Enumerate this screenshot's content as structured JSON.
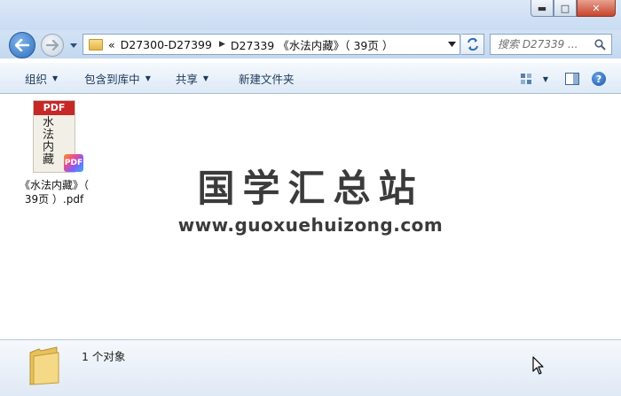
{
  "window": {
    "controls": {
      "minimize": "▬",
      "maximize": "□",
      "close": "✕"
    }
  },
  "address": {
    "overflow": "«",
    "segments": [
      "D27300-D27399",
      "D27339 《水法内藏》（ 39页 ）"
    ],
    "separator": "▶"
  },
  "search": {
    "placeholder": "搜索 D27339 ..."
  },
  "toolbar": {
    "organize": "组织",
    "include_library": "包含到库中",
    "share": "共享",
    "new_folder": "新建文件夹"
  },
  "file": {
    "name": "《水法内藏》（ 39页 ）.pdf",
    "thumb_band": "PDF",
    "thumb_chars": [
      "水",
      "法",
      "内",
      "藏"
    ],
    "badge": "PDF"
  },
  "watermark": {
    "title": "国学汇总站",
    "url": "www.guoxuehuizong.com"
  },
  "details": {
    "count_text": "1 个对象"
  },
  "colors": {
    "accent": "#2e6fc0",
    "pdf_red": "#c62828"
  },
  "icons": [
    "back-arrow-icon",
    "forward-arrow-icon",
    "folder-icon",
    "refresh-icon",
    "search-icon",
    "view-options-icon",
    "preview-pane-icon",
    "help-icon",
    "pdf-icon",
    "mouse-cursor-icon"
  ]
}
